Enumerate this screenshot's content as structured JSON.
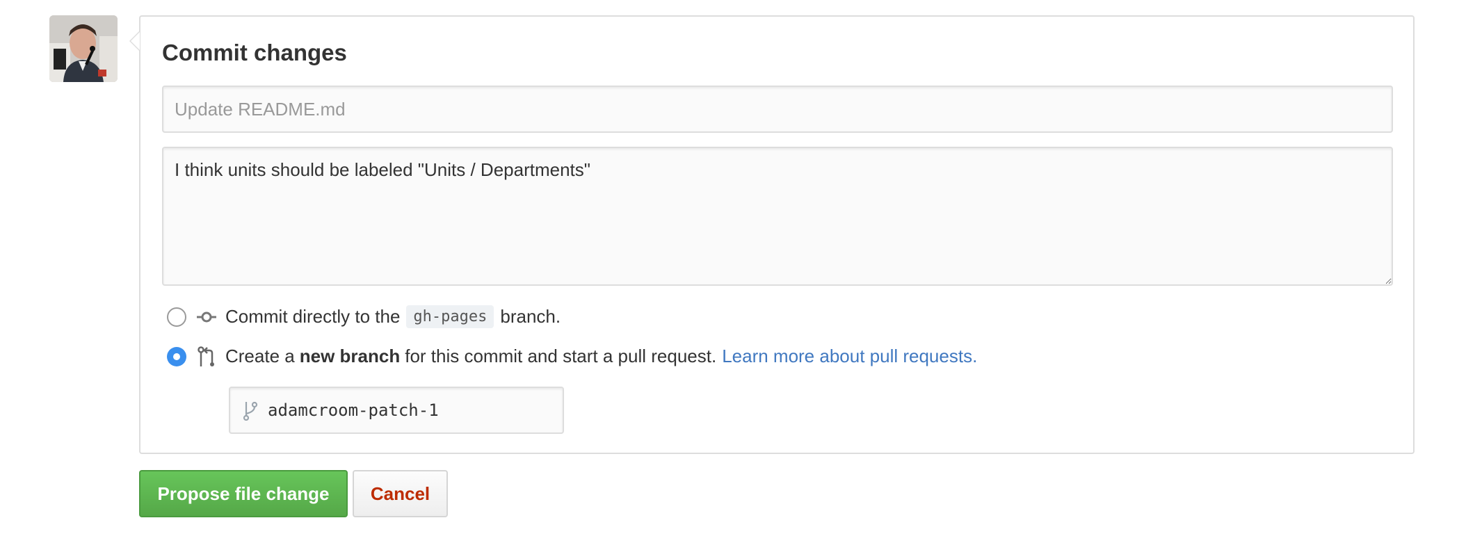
{
  "user": {
    "avatar_icon": "user-avatar"
  },
  "commit": {
    "title": "Commit changes",
    "summary_placeholder": "Update README.md",
    "summary_value": "",
    "description_value": "I think units should be labeled \"Units / Departments\""
  },
  "options": {
    "direct": {
      "checked": false,
      "icon": "git-commit-icon",
      "prefix": "Commit directly to the",
      "branch": "gh-pages",
      "suffix": "branch."
    },
    "new_branch": {
      "checked": true,
      "icon": "git-pull-request-icon",
      "prefix": "Create a",
      "bold": "new branch",
      "suffix": "for this commit and start a pull request.",
      "link": "Learn more about pull requests."
    }
  },
  "branch_name": {
    "icon": "git-branch-icon",
    "value": "adamcroom-patch-1"
  },
  "buttons": {
    "propose_label": "Propose file change",
    "cancel_label": "Cancel"
  },
  "colors": {
    "primary_green": "#5cb24f",
    "cancel_red": "#bd2c00",
    "link_blue": "#4078c0",
    "radio_checked": "#3a8fee"
  }
}
